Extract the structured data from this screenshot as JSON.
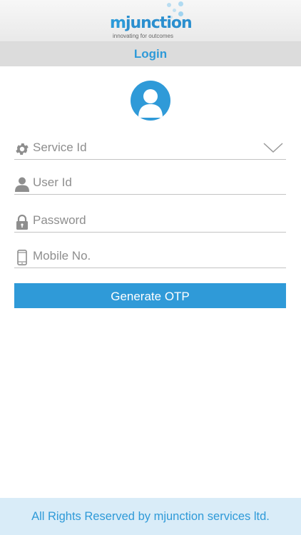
{
  "header": {
    "brand_m": "m",
    "brand_rest": "junction",
    "tagline": "innovating for outcomes"
  },
  "titlebar": {
    "title": "Login"
  },
  "form": {
    "service_id": {
      "placeholder": "Service Id",
      "value": ""
    },
    "user_id": {
      "placeholder": "User Id",
      "value": ""
    },
    "password": {
      "placeholder": "Password",
      "value": ""
    },
    "mobile": {
      "placeholder": "Mobile No.",
      "value": ""
    },
    "submit_label": "Generate OTP"
  },
  "icons": {
    "avatar": "user-avatar-icon",
    "service": "gear-icon",
    "user": "person-icon",
    "password": "lock-icon",
    "mobile": "mobile-phone-icon",
    "dropdown": "chevron-down-icon"
  },
  "colors": {
    "accent": "#2f9ad8",
    "titlebar_bg": "#dcdcdc",
    "footer_bg": "#d9ecf8",
    "field_icon": "#8e8e8e"
  },
  "footer": {
    "text": "All Rights Reserved by mjunction services ltd."
  }
}
